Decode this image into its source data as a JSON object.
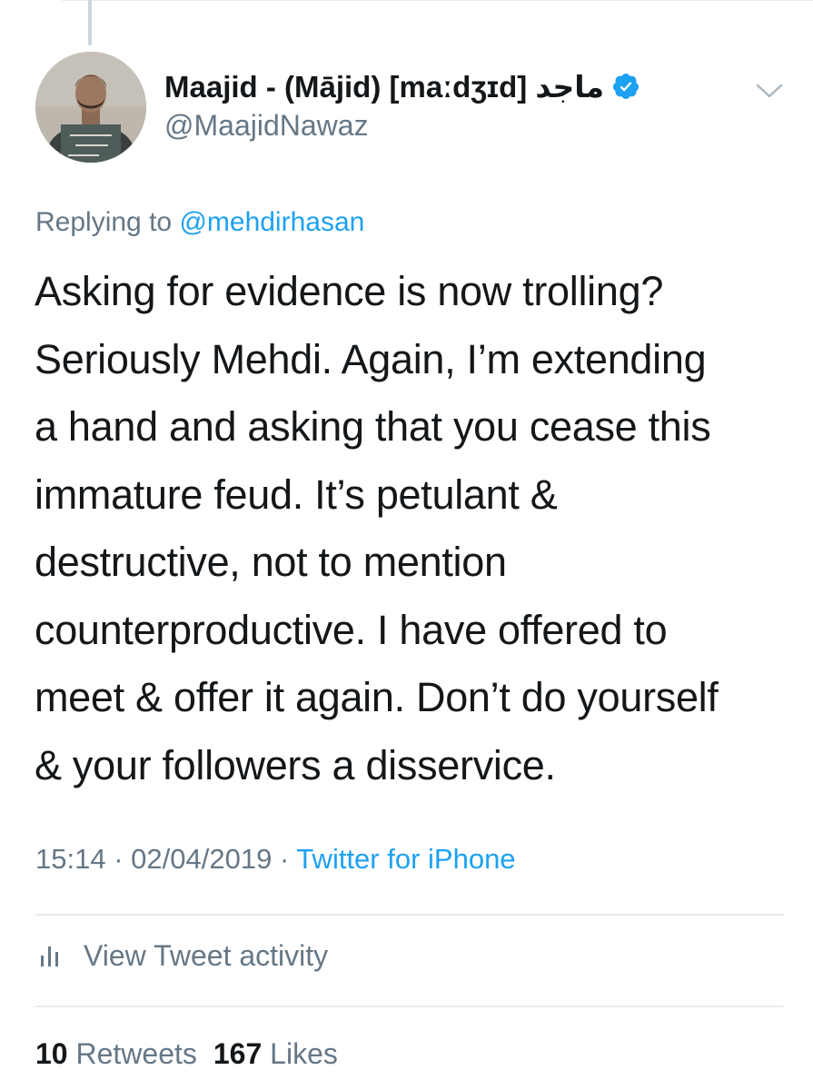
{
  "author": {
    "display_name": "Maajid - (Mājid) [maːdʒɪd] ماجد",
    "handle": "@MaajidNawaz",
    "verified": true,
    "avatar": "profile-photo"
  },
  "reply": {
    "prefix": "Replying to",
    "mention": "@mehdirhasan"
  },
  "tweet": {
    "lines": [
      "Asking for evidence is now trolling?",
      "Seriously Mehdi. Again, I’m extending",
      "a hand and asking that you cease this",
      "immature feud. It’s petulant &",
      "destructive, not to mention",
      "counterproductive. I have offered to",
      "meet & offer it again. Don’t do yourself",
      "& your followers a disservice."
    ]
  },
  "meta": {
    "time": "15:14",
    "separator": "·",
    "date": "02/04/2019",
    "source": "Twitter for iPhone"
  },
  "activity": {
    "label": "View Tweet activity",
    "icon": "bar-chart-icon"
  },
  "stats": {
    "retweets_count": "10",
    "retweets_label": "Retweets",
    "likes_count": "167",
    "likes_label": "Likes"
  },
  "colors": {
    "link": "#1da1f2",
    "secondary_text": "#657786",
    "primary_text": "#14171a",
    "divider": "#e6ecf0"
  }
}
